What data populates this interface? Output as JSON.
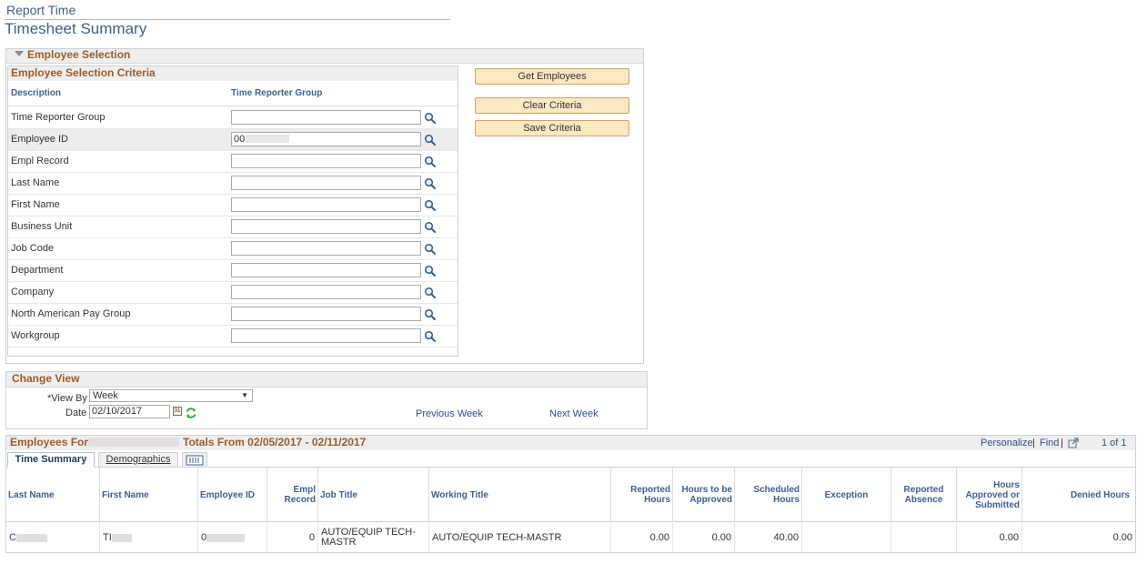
{
  "breadcrumb": "Report Time",
  "page_title": "Timesheet Summary",
  "employee_selection": {
    "title": "Employee Selection",
    "criteria": {
      "title": "Employee Selection Criteria",
      "col_description": "Description",
      "col_value": "Time Reporter Group",
      "rows": [
        {
          "label": "Time Reporter Group",
          "value": ""
        },
        {
          "label": "Employee ID",
          "value": "00"
        },
        {
          "label": "Empl Record",
          "value": ""
        },
        {
          "label": "Last Name",
          "value": ""
        },
        {
          "label": "First Name",
          "value": ""
        },
        {
          "label": "Business Unit",
          "value": ""
        },
        {
          "label": "Job Code",
          "value": ""
        },
        {
          "label": "Department",
          "value": ""
        },
        {
          "label": "Company",
          "value": ""
        },
        {
          "label": "North American Pay Group",
          "value": ""
        },
        {
          "label": "Workgroup",
          "value": ""
        }
      ]
    },
    "buttons": {
      "get_employees": "Get Employees",
      "clear_criteria": "Clear Criteria",
      "save_criteria": "Save Criteria"
    }
  },
  "change_view": {
    "title": "Change View",
    "view_by_label": "*View By",
    "view_by_value": "Week",
    "date_label": "Date",
    "date_value": "02/10/2017",
    "previous_week": "Previous Week",
    "next_week": "Next Week"
  },
  "employees": {
    "title_prefix": "Employees For",
    "title_suffix": "Totals From 02/05/2017 - 02/11/2017",
    "personalize": "Personalize",
    "find": "Find",
    "separator": "|",
    "pager": "1 of 1",
    "tabs": {
      "time_summary": "Time Summary",
      "demographics": "Demographics"
    },
    "columns": {
      "last_name": "Last Name",
      "first_name": "First Name",
      "employee_id": "Employee ID",
      "empl_record": "Empl Record",
      "job_title": "Job Title",
      "working_title": "Working Title",
      "reported_hours": "Reported Hours",
      "hours_to_be_approved": "Hours to be Approved",
      "scheduled_hours": "Scheduled Hours",
      "exception": "Exception",
      "reported_absence": "Reported Absence",
      "hours_approved": "Hours Approved or Submitted",
      "denied_hours": "Denied Hours"
    },
    "rows": [
      {
        "last_name": "C",
        "first_name": "TI",
        "employee_id": "0",
        "empl_record": "0",
        "job_title": "AUTO/EQUIP TECH-MASTR",
        "working_title": "AUTO/EQUIP TECH-MASTR",
        "reported_hours": "0.00",
        "hours_to_be_approved": "0.00",
        "scheduled_hours": "40.00",
        "exception": "",
        "reported_absence": "",
        "hours_approved": "0.00",
        "denied_hours": "0.00"
      }
    ]
  }
}
